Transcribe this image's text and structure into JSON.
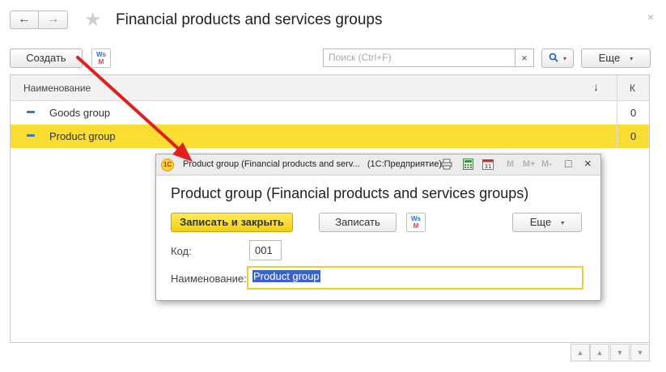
{
  "window": {
    "title": "Financial products and services groups",
    "back_icon": "←",
    "forward_icon": "→",
    "favorite_icon": "★",
    "close_icon": "×"
  },
  "toolbar": {
    "create_label": "Создать",
    "ws_icon_top": "Ws",
    "ws_icon_bottom": "M",
    "search_placeholder": "Поиск (Ctrl+F)",
    "search_clear": "×",
    "search_button_icon": "🔍",
    "more_label": "Еще",
    "dropdown_arrow": "▾"
  },
  "list": {
    "columns": {
      "name": "Наименование",
      "code": "К",
      "sort_icon": "↓"
    },
    "rows": [
      {
        "name": "Goods group",
        "code": "0",
        "selected": false
      },
      {
        "name": "Product group",
        "code": "0",
        "selected": true
      }
    ],
    "scroll_buttons": [
      "▲",
      "▲",
      "▼",
      "▼"
    ]
  },
  "dialog": {
    "caption": "Product group (Financial products and serv...",
    "app_name": "(1C:Предприятие)",
    "logo_text": "1C",
    "toolbar_memory": [
      "M",
      "M+",
      "M-"
    ],
    "maximize_icon": "□",
    "close_icon": "×",
    "title": "Product group (Financial products and services groups)",
    "save_close_label": "Записать и закрыть",
    "save_label": "Записать",
    "more_label": "Еще",
    "code_label": "Код:",
    "code_value": "001",
    "name_label": "Наименование:",
    "name_value": "Product group"
  },
  "colors": {
    "selection_yellow": "#f9dd32",
    "annotation_arrow": "#e0201c",
    "text_selection": "#3b62c6"
  }
}
